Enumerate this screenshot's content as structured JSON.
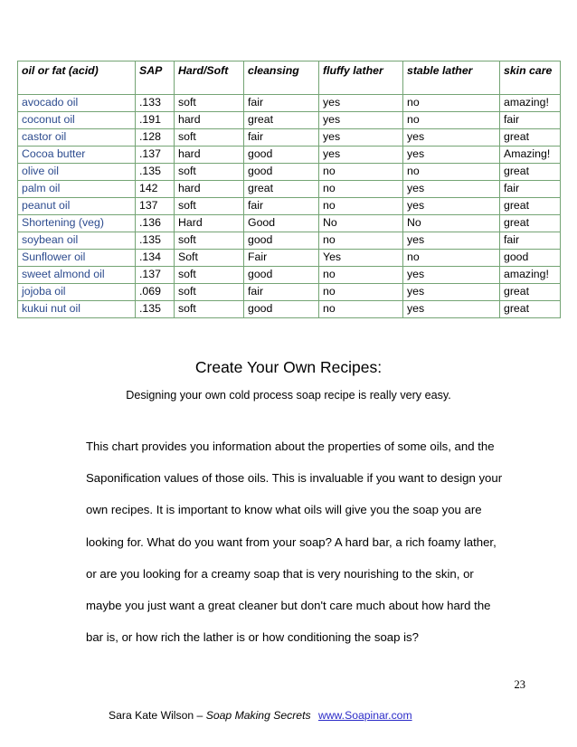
{
  "page": {
    "number": "23"
  },
  "table": {
    "columns": [
      "oil or fat (acid)",
      "SAP",
      "Hard/Soft",
      "cleansing",
      "fluffy lather",
      "stable lather",
      "skin care"
    ],
    "rows": [
      [
        "avocado oil",
        ".133",
        "soft",
        "fair",
        "yes",
        "no",
        "amazing!"
      ],
      [
        "coconut oil",
        ".191",
        "hard",
        "great",
        "yes",
        "no",
        "fair"
      ],
      [
        "castor oil",
        ".128",
        "soft",
        "fair",
        "yes",
        "yes",
        "great"
      ],
      [
        "Cocoa butter",
        ".137",
        "hard",
        "good",
        "yes",
        "yes",
        "Amazing!"
      ],
      [
        "olive oil",
        ".135",
        "soft",
        "good",
        "no",
        "no",
        "great"
      ],
      [
        "palm oil",
        "142",
        "hard",
        "great",
        "no",
        "yes",
        "fair"
      ],
      [
        "peanut oil",
        "137",
        "soft",
        "fair",
        "no",
        "yes",
        "great"
      ],
      [
        "Shortening (veg)",
        ".136",
        "Hard",
        "Good",
        "No",
        "No",
        "great"
      ],
      [
        "soybean oil",
        ".135",
        "soft",
        "good",
        "no",
        "yes",
        "fair"
      ],
      [
        "Sunflower oil",
        ".134",
        "Soft",
        "Fair",
        "Yes",
        "no",
        "good"
      ],
      [
        "sweet almond oil",
        ".137",
        "soft",
        "good",
        "no",
        "yes",
        "amazing!"
      ],
      [
        "jojoba oil",
        ".069",
        "soft",
        "fair",
        "no",
        "yes",
        "great"
      ],
      [
        "kukui nut oil",
        ".135",
        "soft",
        "good",
        "no",
        "yes",
        "great"
      ]
    ]
  },
  "content": {
    "heading": "Create Your Own Recipes:",
    "subtitle": "Designing your own cold process soap recipe is really very easy.",
    "paragraph": "This chart provides you information about the properties of some oils, and the Saponification values of those oils. This is invaluable if you want to design your own recipes. It is important to know what oils will give you the soap you are looking for. What do you want from your soap? A hard bar, a rich foamy lather, or are you looking for a creamy soap  that is very nourishing to the skin, or maybe you just want a great cleaner but don't care much about how hard the bar is, or how rich the lather is or how conditioning the soap is?"
  },
  "footer": {
    "author": "Sara Kate Wilson –",
    "book_title": "Soap Making Secrets",
    "website": "www.Soapinar.com"
  },
  "colors": {
    "table_border": "#74a474",
    "oil_name_text": "#2c4b8e",
    "link": "#2b2bc8",
    "page_background": "#ffffff"
  }
}
